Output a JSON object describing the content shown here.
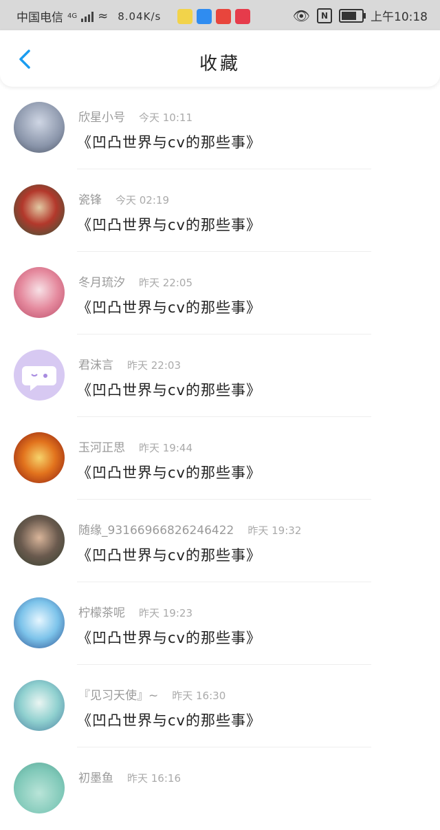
{
  "status_bar": {
    "carrier": "中国电信",
    "network": "4G",
    "speed": "8.04K/s",
    "time": "上午10:18",
    "battery_level": 0.8
  },
  "header": {
    "title": "收藏",
    "accent_color": "#1a9cf0"
  },
  "items": [
    {
      "name": "欣星小号",
      "time": "今天 10:11",
      "message": "《凹凸世界与cv的那些事》"
    },
    {
      "name": "瓷锋",
      "time": "今天 02:19",
      "message": "《凹凸世界与cv的那些事》"
    },
    {
      "name": "冬月琉汐",
      "time": "昨天 22:05",
      "message": "《凹凸世界与cv的那些事》"
    },
    {
      "name": "君沫言",
      "time": "昨天 22:03",
      "message": "《凹凸世界与cv的那些事》"
    },
    {
      "name": "玉河正思",
      "time": "昨天 19:44",
      "message": "《凹凸世界与cv的那些事》"
    },
    {
      "name": "随缘_93166966826246422",
      "time": "昨天 19:32",
      "message": "《凹凸世界与cv的那些事》"
    },
    {
      "name": "柠檬茶呢",
      "time": "昨天 19:23",
      "message": "《凹凸世界与cv的那些事》"
    },
    {
      "name": "『见习天使』~",
      "time": "昨天 16:30",
      "message": "《凹凸世界与cv的那些事》"
    },
    {
      "name": "初墨鱼",
      "time": "昨天 16:16",
      "message": ""
    }
  ]
}
